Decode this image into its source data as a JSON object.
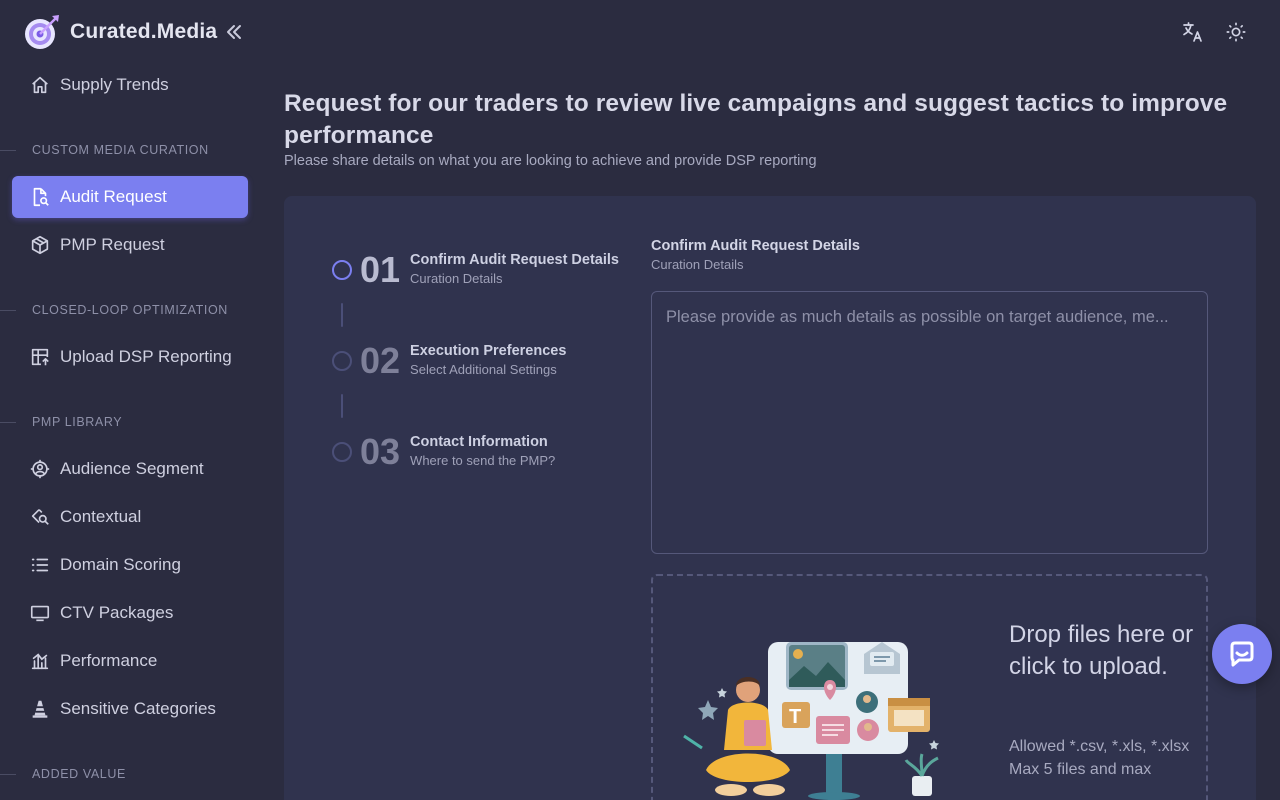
{
  "app": {
    "name": "Curated.Media"
  },
  "sidebar": {
    "items": [
      {
        "label": "Supply Trends",
        "icon": "home-icon"
      },
      {
        "label": "Audit Request",
        "icon": "file-search-icon",
        "active": true
      },
      {
        "label": "PMP Request",
        "icon": "package-icon"
      },
      {
        "label": "Upload DSP Reporting",
        "icon": "table-upload-icon"
      },
      {
        "label": "Audience Segment",
        "icon": "target-user-icon"
      },
      {
        "label": "Contextual",
        "icon": "zoom-search-icon"
      },
      {
        "label": "Domain Scoring",
        "icon": "list-icon"
      },
      {
        "label": "CTV Packages",
        "icon": "tv-icon"
      },
      {
        "label": "Performance",
        "icon": "chart-bar-icon"
      },
      {
        "label": "Sensitive Categories",
        "icon": "cone-icon"
      }
    ],
    "sections": [
      "CUSTOM MEDIA CURATION",
      "CLOSED-LOOP OPTIMIZATION",
      "PMP LIBRARY",
      "ADDED VALUE"
    ]
  },
  "header": {
    "title": "Request for our traders to review live campaigns and suggest tactics to improve performance",
    "subtitle": "Please share details on what you are looking to achieve and provide DSP reporting"
  },
  "stepper": {
    "steps": [
      {
        "number": "01",
        "title": "Confirm Audit Request Details",
        "subtitle": "Curation Details",
        "active": true
      },
      {
        "number": "02",
        "title": "Execution Preferences",
        "subtitle": "Select Additional Settings"
      },
      {
        "number": "03",
        "title": "Contact Information",
        "subtitle": "Where to send the PMP?"
      }
    ]
  },
  "form": {
    "title": "Confirm Audit Request Details",
    "subtitle": "Curation Details",
    "details_placeholder": "Please provide as much details as possible on target audience, me..."
  },
  "dropzone": {
    "title": "Drop files here or click to upload.",
    "allowed": "Allowed *.csv, *.xls, *.xlsx",
    "limit": "Max 5 files and max"
  },
  "colors": {
    "accent": "#7b7ff0",
    "background": "#2b2c40",
    "card": "#30334e"
  }
}
